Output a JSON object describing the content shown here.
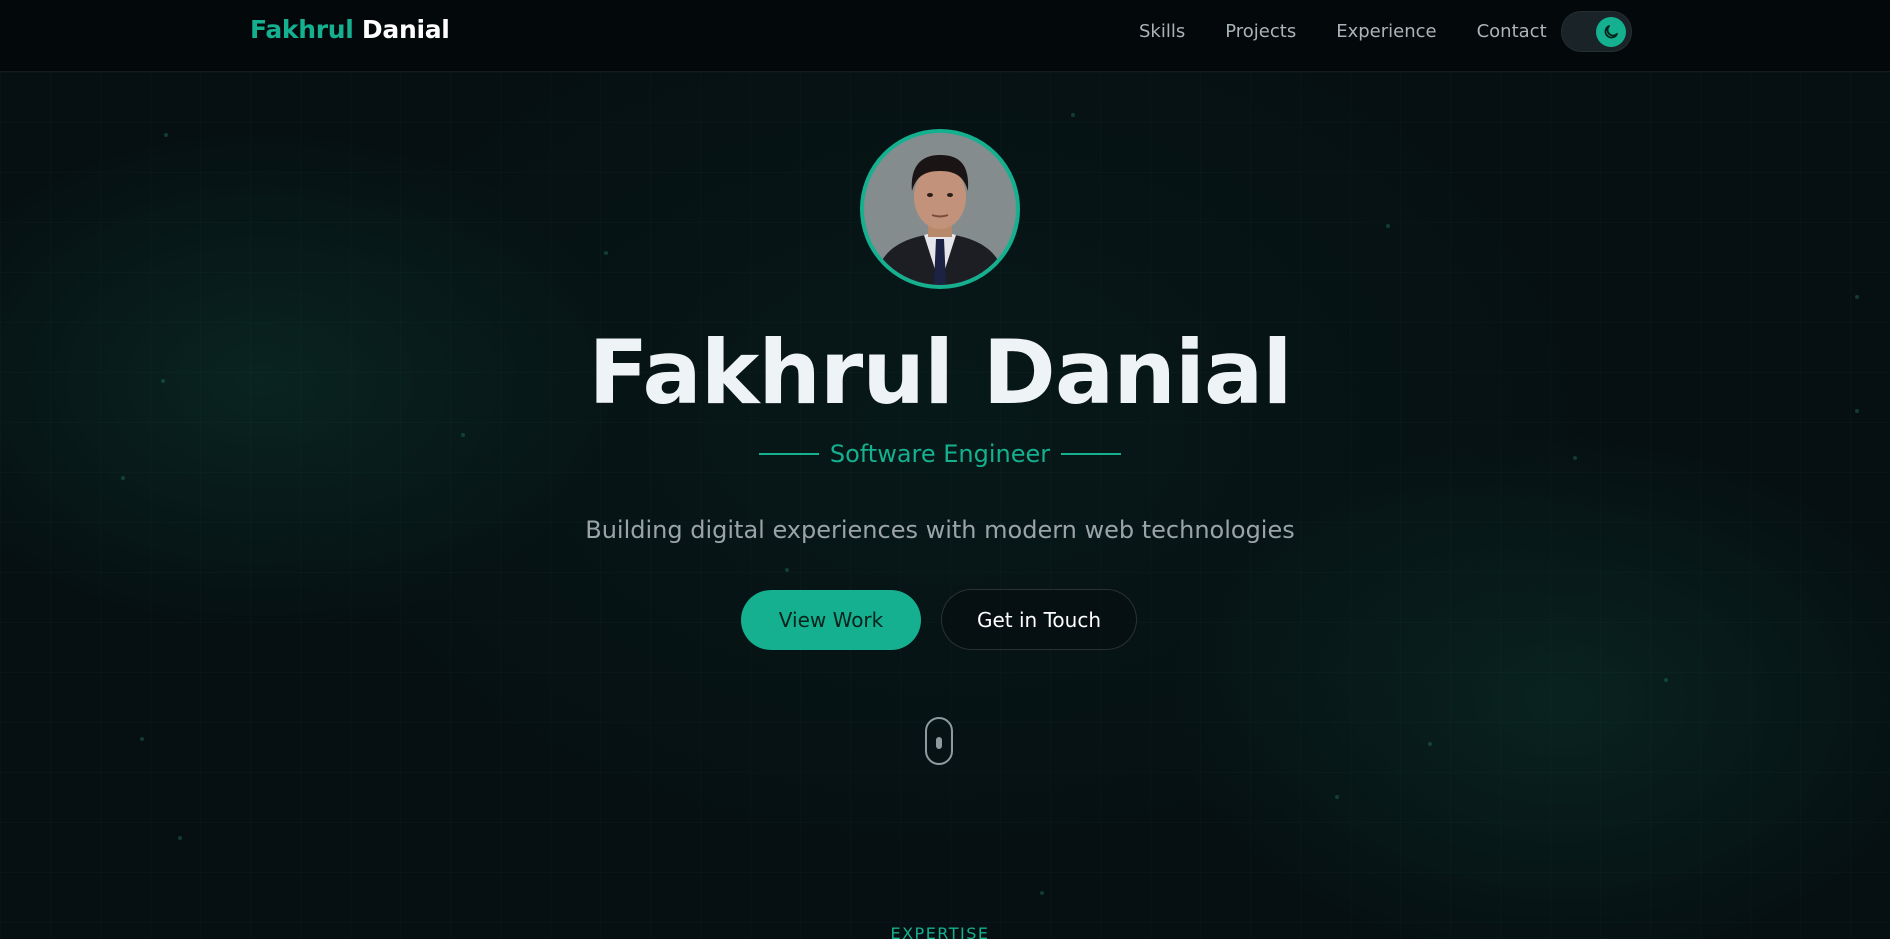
{
  "nav": {
    "logo_first": "Fakhrul",
    "logo_last": "Danial",
    "links": [
      "Skills",
      "Projects",
      "Experience",
      "Contact"
    ],
    "theme_toggle_icon": "moon-icon"
  },
  "hero": {
    "avatar_icon": "profile-photo",
    "name": "Fakhrul Danial",
    "role": "Software Engineer",
    "tagline": "Building digital experiences with modern web technologies",
    "primary_button": "View Work",
    "secondary_button": "Get in Touch",
    "scroll_icon": "mouse-scroll-icon"
  },
  "next_section": {
    "label": "EXPERTISE"
  },
  "colors": {
    "accent": "#14b08f",
    "background": "#061012",
    "text": "#eef3f5",
    "muted": "#9aa4a8"
  }
}
